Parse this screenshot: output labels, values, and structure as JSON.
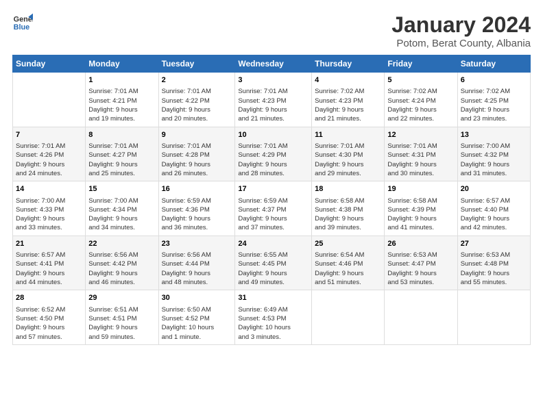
{
  "logo": {
    "line1": "General",
    "line2": "Blue"
  },
  "title": "January 2024",
  "subtitle": "Potom, Berat County, Albania",
  "days_header": [
    "Sunday",
    "Monday",
    "Tuesday",
    "Wednesday",
    "Thursday",
    "Friday",
    "Saturday"
  ],
  "weeks": [
    [
      {
        "num": "",
        "info": ""
      },
      {
        "num": "1",
        "info": "Sunrise: 7:01 AM\nSunset: 4:21 PM\nDaylight: 9 hours\nand 19 minutes."
      },
      {
        "num": "2",
        "info": "Sunrise: 7:01 AM\nSunset: 4:22 PM\nDaylight: 9 hours\nand 20 minutes."
      },
      {
        "num": "3",
        "info": "Sunrise: 7:01 AM\nSunset: 4:23 PM\nDaylight: 9 hours\nand 21 minutes."
      },
      {
        "num": "4",
        "info": "Sunrise: 7:02 AM\nSunset: 4:23 PM\nDaylight: 9 hours\nand 21 minutes."
      },
      {
        "num": "5",
        "info": "Sunrise: 7:02 AM\nSunset: 4:24 PM\nDaylight: 9 hours\nand 22 minutes."
      },
      {
        "num": "6",
        "info": "Sunrise: 7:02 AM\nSunset: 4:25 PM\nDaylight: 9 hours\nand 23 minutes."
      }
    ],
    [
      {
        "num": "7",
        "info": "Sunrise: 7:01 AM\nSunset: 4:26 PM\nDaylight: 9 hours\nand 24 minutes."
      },
      {
        "num": "8",
        "info": "Sunrise: 7:01 AM\nSunset: 4:27 PM\nDaylight: 9 hours\nand 25 minutes."
      },
      {
        "num": "9",
        "info": "Sunrise: 7:01 AM\nSunset: 4:28 PM\nDaylight: 9 hours\nand 26 minutes."
      },
      {
        "num": "10",
        "info": "Sunrise: 7:01 AM\nSunset: 4:29 PM\nDaylight: 9 hours\nand 28 minutes."
      },
      {
        "num": "11",
        "info": "Sunrise: 7:01 AM\nSunset: 4:30 PM\nDaylight: 9 hours\nand 29 minutes."
      },
      {
        "num": "12",
        "info": "Sunrise: 7:01 AM\nSunset: 4:31 PM\nDaylight: 9 hours\nand 30 minutes."
      },
      {
        "num": "13",
        "info": "Sunrise: 7:00 AM\nSunset: 4:32 PM\nDaylight: 9 hours\nand 31 minutes."
      }
    ],
    [
      {
        "num": "14",
        "info": "Sunrise: 7:00 AM\nSunset: 4:33 PM\nDaylight: 9 hours\nand 33 minutes."
      },
      {
        "num": "15",
        "info": "Sunrise: 7:00 AM\nSunset: 4:34 PM\nDaylight: 9 hours\nand 34 minutes."
      },
      {
        "num": "16",
        "info": "Sunrise: 6:59 AM\nSunset: 4:36 PM\nDaylight: 9 hours\nand 36 minutes."
      },
      {
        "num": "17",
        "info": "Sunrise: 6:59 AM\nSunset: 4:37 PM\nDaylight: 9 hours\nand 37 minutes."
      },
      {
        "num": "18",
        "info": "Sunrise: 6:58 AM\nSunset: 4:38 PM\nDaylight: 9 hours\nand 39 minutes."
      },
      {
        "num": "19",
        "info": "Sunrise: 6:58 AM\nSunset: 4:39 PM\nDaylight: 9 hours\nand 41 minutes."
      },
      {
        "num": "20",
        "info": "Sunrise: 6:57 AM\nSunset: 4:40 PM\nDaylight: 9 hours\nand 42 minutes."
      }
    ],
    [
      {
        "num": "21",
        "info": "Sunrise: 6:57 AM\nSunset: 4:41 PM\nDaylight: 9 hours\nand 44 minutes."
      },
      {
        "num": "22",
        "info": "Sunrise: 6:56 AM\nSunset: 4:42 PM\nDaylight: 9 hours\nand 46 minutes."
      },
      {
        "num": "23",
        "info": "Sunrise: 6:56 AM\nSunset: 4:44 PM\nDaylight: 9 hours\nand 48 minutes."
      },
      {
        "num": "24",
        "info": "Sunrise: 6:55 AM\nSunset: 4:45 PM\nDaylight: 9 hours\nand 49 minutes."
      },
      {
        "num": "25",
        "info": "Sunrise: 6:54 AM\nSunset: 4:46 PM\nDaylight: 9 hours\nand 51 minutes."
      },
      {
        "num": "26",
        "info": "Sunrise: 6:53 AM\nSunset: 4:47 PM\nDaylight: 9 hours\nand 53 minutes."
      },
      {
        "num": "27",
        "info": "Sunrise: 6:53 AM\nSunset: 4:48 PM\nDaylight: 9 hours\nand 55 minutes."
      }
    ],
    [
      {
        "num": "28",
        "info": "Sunrise: 6:52 AM\nSunset: 4:50 PM\nDaylight: 9 hours\nand 57 minutes."
      },
      {
        "num": "29",
        "info": "Sunrise: 6:51 AM\nSunset: 4:51 PM\nDaylight: 9 hours\nand 59 minutes."
      },
      {
        "num": "30",
        "info": "Sunrise: 6:50 AM\nSunset: 4:52 PM\nDaylight: 10 hours\nand 1 minute."
      },
      {
        "num": "31",
        "info": "Sunrise: 6:49 AM\nSunset: 4:53 PM\nDaylight: 10 hours\nand 3 minutes."
      },
      {
        "num": "",
        "info": ""
      },
      {
        "num": "",
        "info": ""
      },
      {
        "num": "",
        "info": ""
      }
    ]
  ]
}
